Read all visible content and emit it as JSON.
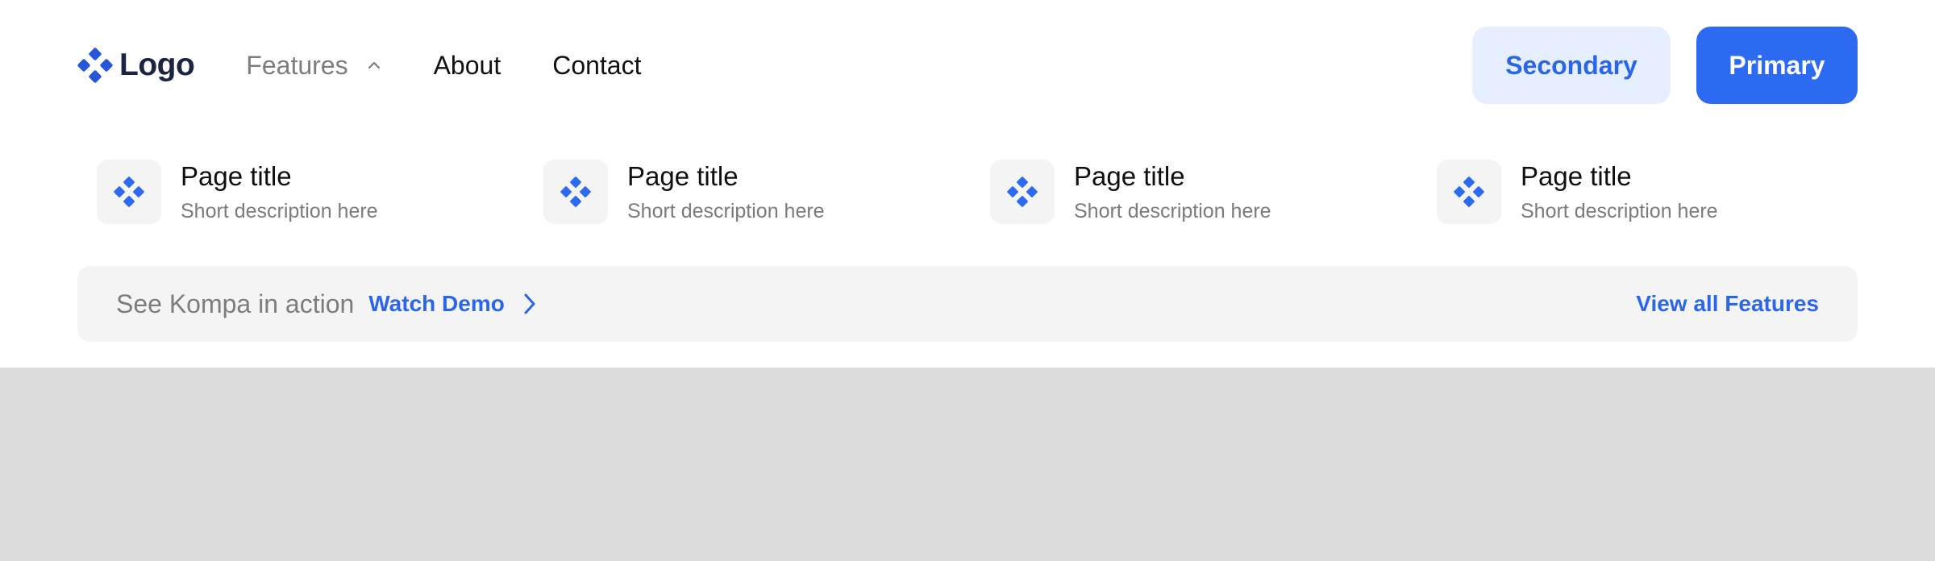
{
  "header": {
    "logo_text": "Logo",
    "nav": [
      {
        "label": "Features",
        "active": true,
        "has_chevron": true
      },
      {
        "label": "About",
        "active": false
      },
      {
        "label": "Contact",
        "active": false
      }
    ],
    "secondary_label": "Secondary",
    "primary_label": "Primary"
  },
  "features": [
    {
      "title": "Page title",
      "description": "Short description here",
      "icon": "diamond-cluster-icon"
    },
    {
      "title": "Page title",
      "description": "Short description here",
      "icon": "diamond-cluster-icon"
    },
    {
      "title": "Page title",
      "description": "Short description here",
      "icon": "diamond-cluster-icon"
    },
    {
      "title": "Page title",
      "description": "Short description here",
      "icon": "diamond-cluster-icon"
    }
  ],
  "footer_bar": {
    "tagline": "See Kompa in action",
    "demo_label": "Watch Demo",
    "view_all_label": "View all Features"
  },
  "colors": {
    "accent": "#2d6af2",
    "accent_light": "#e6efff",
    "logo_text": "#1b2540",
    "muted": "#7d7d80",
    "surface": "#f4f4f4",
    "backdrop": "#dcdcdc"
  }
}
